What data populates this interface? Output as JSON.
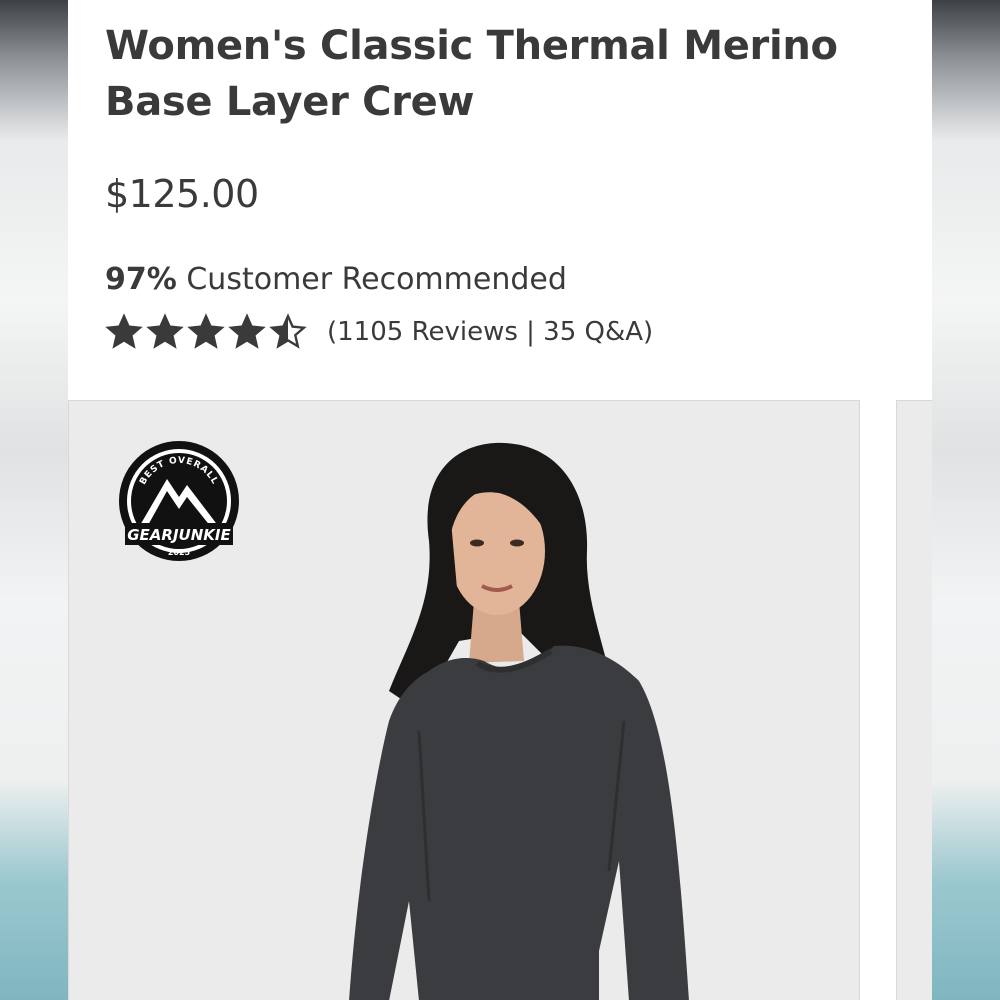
{
  "product": {
    "title": "Women's Classic Thermal Merino Base Layer Crew",
    "price": "$125.00",
    "recommend_percent": "97%",
    "recommend_label": "Customer Recommended",
    "rating": 4.5,
    "rating_max": 5,
    "reviews_text": "(1105 Reviews | 35 Q&A)"
  },
  "badge": {
    "top_text": "BEST OVERALL",
    "brand": "GEARJUNKIE",
    "year": "2025"
  },
  "colors": {
    "text": "#3a3a3a",
    "star": "#3a3a3a",
    "gallery_bg": "#ebebeb"
  }
}
